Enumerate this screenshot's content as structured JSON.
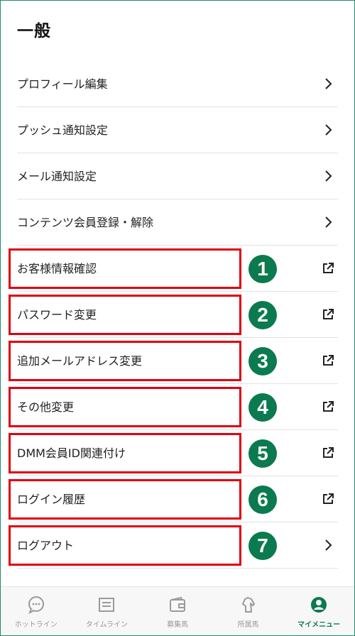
{
  "header": {
    "title": "一般"
  },
  "menu": {
    "items": [
      {
        "label": "プロフィール編集",
        "icon": "chevron-right-icon"
      },
      {
        "label": "プッシュ通知設定",
        "icon": "chevron-right-icon"
      },
      {
        "label": "メール通知設定",
        "icon": "chevron-right-icon"
      },
      {
        "label": "コンテンツ会員登録・解除",
        "icon": "chevron-right-icon"
      },
      {
        "label": "お客様情報確認",
        "icon": "external-link-icon",
        "badge": "1"
      },
      {
        "label": "パスワード変更",
        "icon": "external-link-icon",
        "badge": "2"
      },
      {
        "label": "追加メールアドレス変更",
        "icon": "external-link-icon",
        "badge": "3"
      },
      {
        "label": "その他変更",
        "icon": "external-link-icon",
        "badge": "4"
      },
      {
        "label": "DMM会員ID関連付け",
        "icon": "external-link-icon",
        "badge": "5"
      },
      {
        "label": "ログイン履歴",
        "icon": "external-link-icon",
        "badge": "6"
      },
      {
        "label": "ログアウト",
        "icon": "chevron-right-icon",
        "badge": "7"
      }
    ]
  },
  "annotation": {
    "highlight_color": "#e0000f",
    "badge_color": "#0b7a4f"
  },
  "tabbar": {
    "active_color": "#0b7a4f",
    "tabs": [
      {
        "label": "ホットライン",
        "icon": "chat-bubble-icon"
      },
      {
        "label": "タイムライン",
        "icon": "timeline-icon"
      },
      {
        "label": "募集馬",
        "icon": "wallet-icon"
      },
      {
        "label": "所属馬",
        "icon": "horse-icon"
      },
      {
        "label": "マイメニュー",
        "icon": "user-circle-icon",
        "active": true
      }
    ]
  }
}
